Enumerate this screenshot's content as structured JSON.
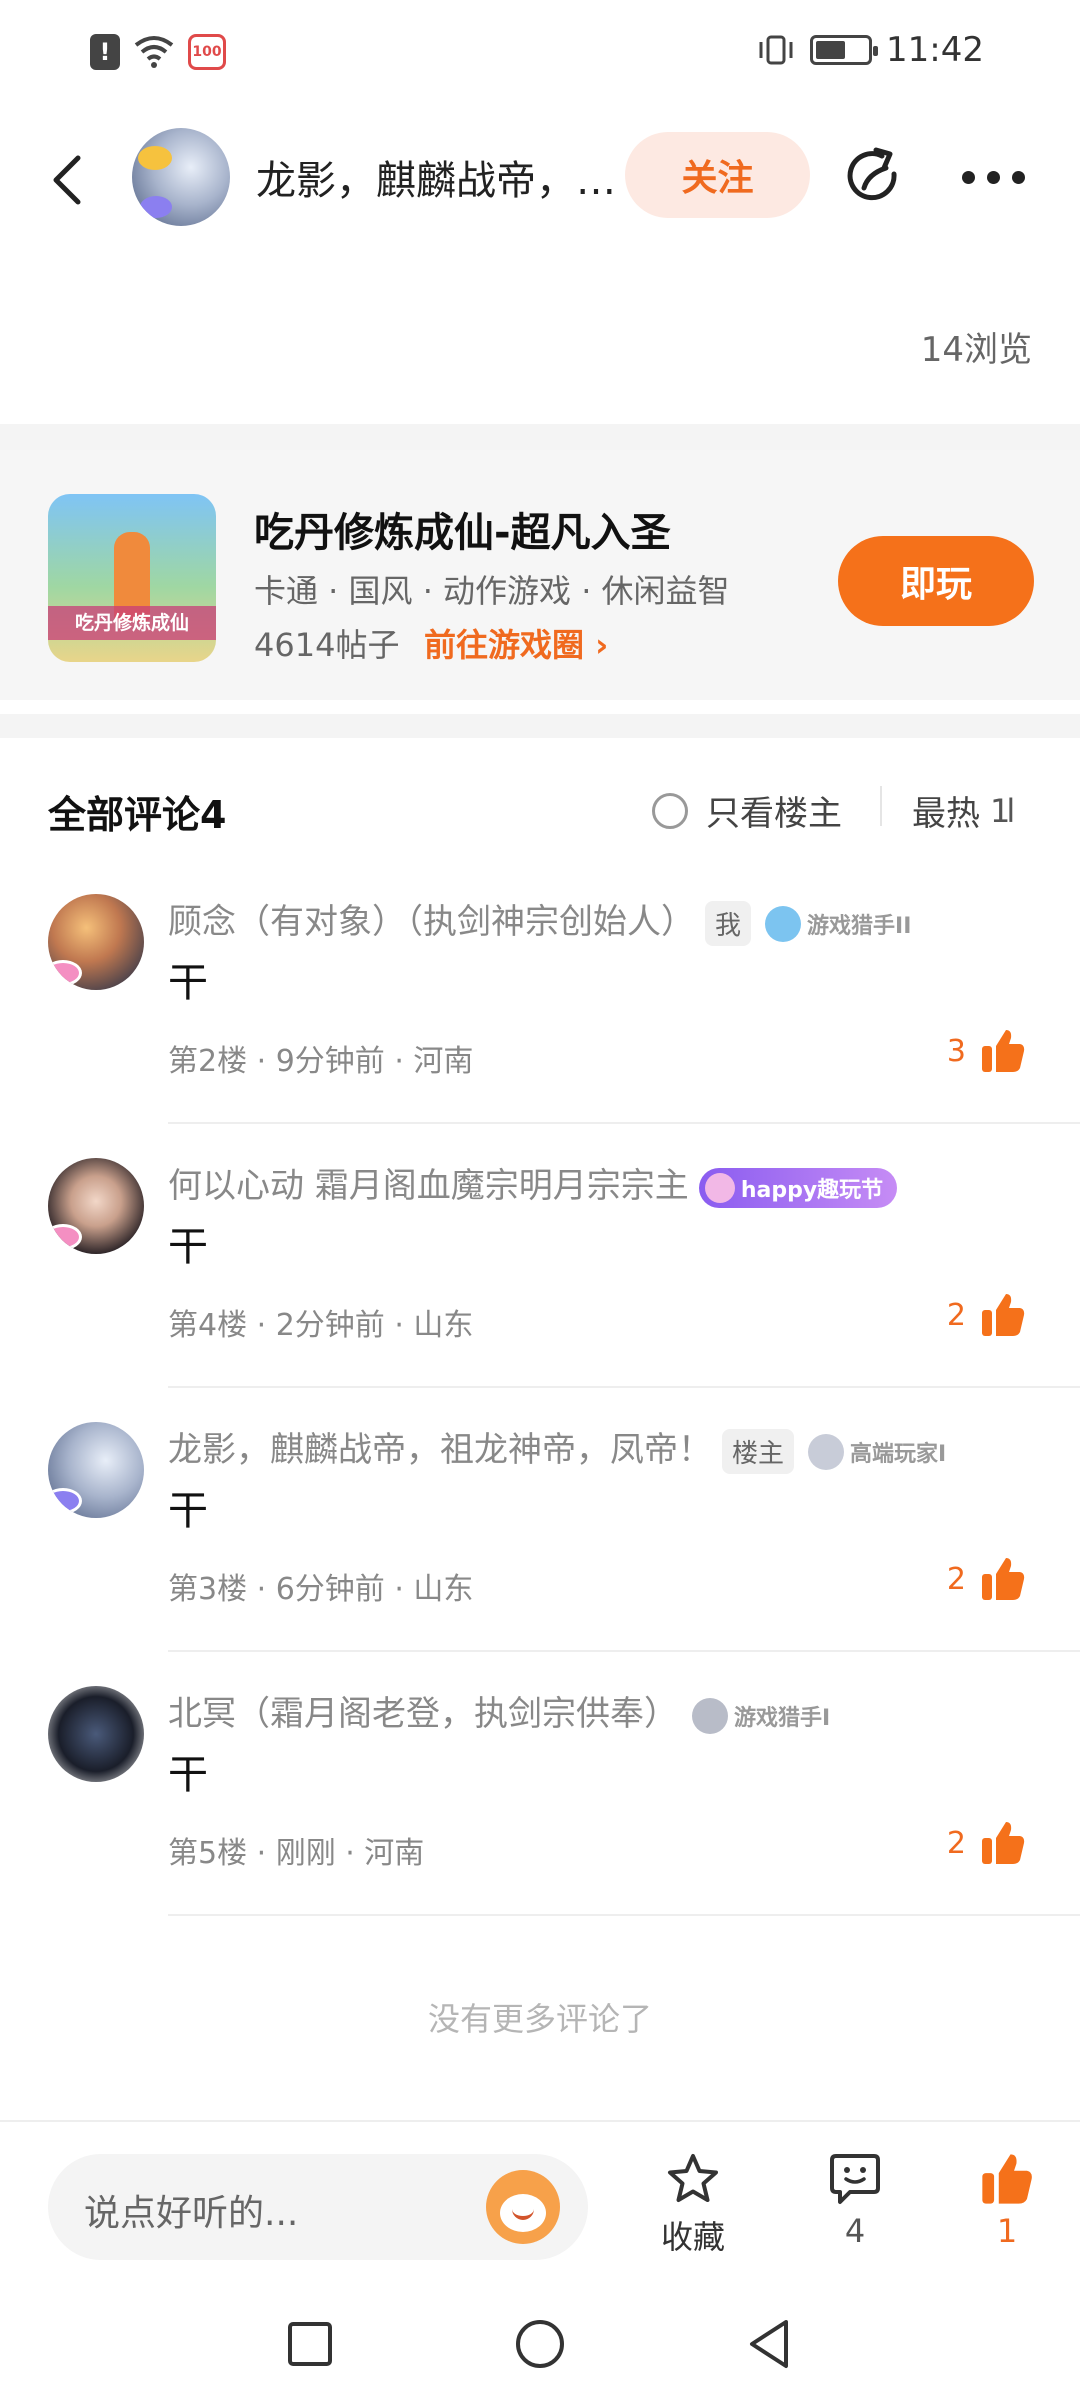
{
  "status_bar": {
    "time": "11:42",
    "app_badge": "100"
  },
  "header": {
    "title": "龙影，麒麟战帝，祖龙神帝，凤帝！",
    "follow_label": "关注"
  },
  "post": {
    "views": "14浏览"
  },
  "game_card": {
    "name": "吃丹修炼成仙-超凡入圣",
    "tags": "卡通 · 国风 · 动作游戏 · 休闲益智",
    "posts": "4614帖子",
    "circle_link": "前往游戏圈 ›",
    "play_label": "即玩",
    "icon_banner": "吃丹修炼成仙"
  },
  "comments_section": {
    "title": "全部评论4",
    "only_op_label": "只看楼主",
    "sort_label": "最热",
    "sort_icon": "1l",
    "no_more": "没有更多评论了"
  },
  "comments": [
    {
      "name": "顾念（有对象）（执剑神宗创始人）",
      "badge": "我",
      "medal": "游戏猎手II",
      "text": "干",
      "meta": "第2楼 · 9分钟前 · 河南",
      "likes": "3"
    },
    {
      "name": "何以心动 霜月阁血魔宗明月宗宗主",
      "medal": "happy趣玩节",
      "text": "干",
      "meta": "第4楼 · 2分钟前 · 山东",
      "likes": "2"
    },
    {
      "name": "龙影，麒麟战帝，祖龙神帝，凤帝！",
      "badge": "楼主",
      "medal": "高端玩家I",
      "text": "干",
      "meta": "第3楼 · 6分钟前 · 山东",
      "likes": "2"
    },
    {
      "name": "北冥（霜月阁老登，执剑宗供奉）",
      "medal": "游戏猎手I",
      "text": "干",
      "meta": "第5楼 · 刚刚 · 河南",
      "likes": "2"
    }
  ],
  "bottom_bar": {
    "input_placeholder": "说点好听的...",
    "favorite_label": "收藏",
    "comment_count": "4",
    "like_count": "1"
  },
  "colors": {
    "accent": "#f5711a",
    "accent_text": "#f06a1f",
    "follow_bg": "#fde9e2"
  }
}
